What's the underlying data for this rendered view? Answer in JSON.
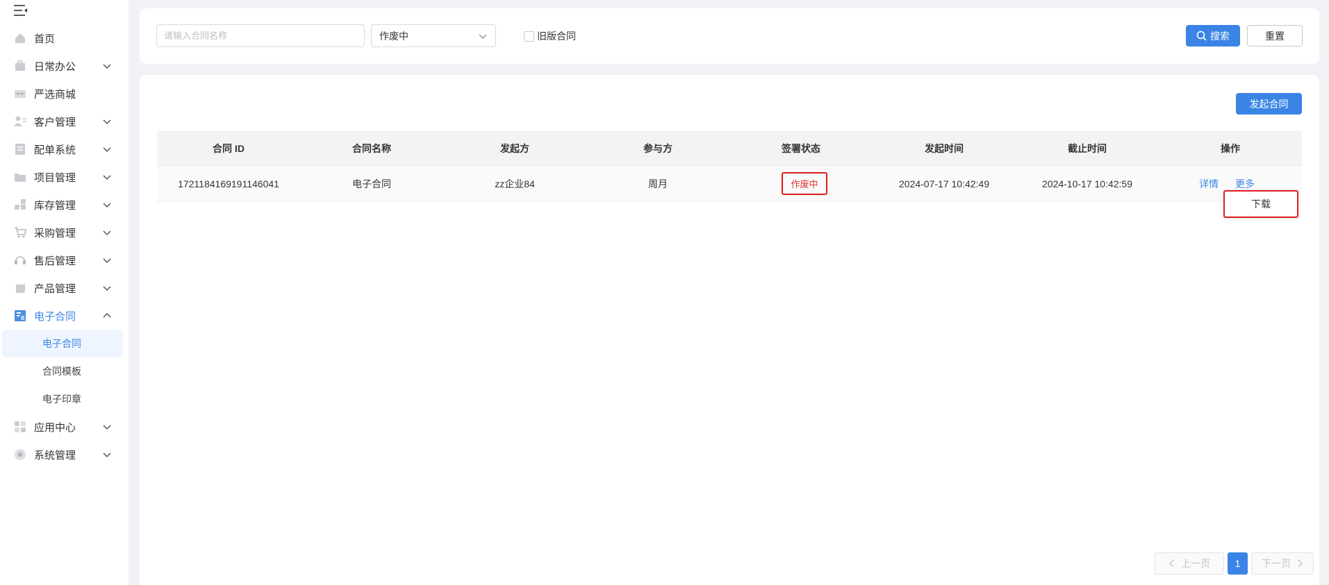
{
  "sidebar": {
    "items": [
      {
        "label": "首页",
        "icon": "home-icon",
        "expandable": false
      },
      {
        "label": "日常办公",
        "icon": "briefcase-icon",
        "expandable": true
      },
      {
        "label": "严选商城",
        "icon": "store-icon",
        "expandable": false
      },
      {
        "label": "客户管理",
        "icon": "customer-icon",
        "expandable": true
      },
      {
        "label": "配单系统",
        "icon": "order-icon",
        "expandable": true
      },
      {
        "label": "项目管理",
        "icon": "folder-icon",
        "expandable": true
      },
      {
        "label": "库存管理",
        "icon": "inventory-icon",
        "expandable": true
      },
      {
        "label": "采购管理",
        "icon": "cart-icon",
        "expandable": true
      },
      {
        "label": "售后管理",
        "icon": "headset-icon",
        "expandable": true
      },
      {
        "label": "产品管理",
        "icon": "product-icon",
        "expandable": true
      },
      {
        "label": "电子合同",
        "icon": "contract-icon",
        "expandable": true,
        "open": true
      },
      {
        "label": "应用中心",
        "icon": "apps-icon",
        "expandable": true
      },
      {
        "label": "系统管理",
        "icon": "settings-icon",
        "expandable": true
      }
    ],
    "submenu": [
      {
        "label": "电子合同",
        "active": true
      },
      {
        "label": "合同模板",
        "active": false
      },
      {
        "label": "电子印章",
        "active": false
      }
    ]
  },
  "search": {
    "name_placeholder": "请输入合同名称",
    "status_value": "作废中",
    "legacy_label": "旧版合同",
    "search_label": "搜索",
    "reset_label": "重置"
  },
  "main": {
    "create_label": "发起合同"
  },
  "table": {
    "headers": [
      "合同 ID",
      "合同名称",
      "发起方",
      "参与方",
      "签署状态",
      "发起时间",
      "截止时间",
      "操作"
    ],
    "rows": [
      {
        "id": "1721184169191146041",
        "name": "电子合同",
        "initiator": "zz企业84",
        "participant": "周月",
        "status": "作废中",
        "start_time": "2024-07-17 10:42:49",
        "end_time": "2024-10-17 10:42:59",
        "action_detail": "详情",
        "action_more": "更多"
      }
    ]
  },
  "dropdown": {
    "download_label": "下载"
  },
  "pagination": {
    "prev_label": "上一页",
    "current_page": "1",
    "next_label": "下一页"
  },
  "colors": {
    "accent": "#3a84e6",
    "status_red": "#e5332c",
    "highlight_border": "#e01b1b"
  }
}
